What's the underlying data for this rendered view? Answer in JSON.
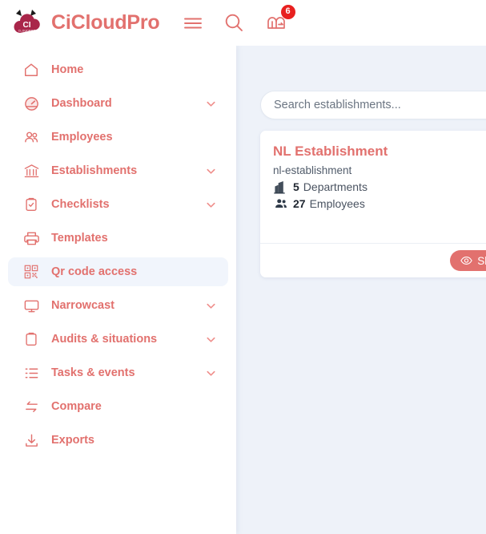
{
  "header": {
    "logo_alt": "cicloudpro-logo",
    "brand": "CiCloudPro",
    "logo_text": "CI",
    "icons": [
      {
        "name": "hamburger-menu-icon",
        "label": "Menu"
      },
      {
        "name": "search-icon",
        "label": "Search"
      },
      {
        "name": "mailbox-icon",
        "label": "Inbox"
      }
    ],
    "mailbox_badge": "6",
    "brand_color": "#e2716e",
    "badge_color": "#e8201f"
  },
  "sidebar": {
    "active_item": "Qr code access",
    "active_bg": "#f1f5fc",
    "items": [
      {
        "label": "Home",
        "icon": "home-icon",
        "chevron": false
      },
      {
        "label": "Dashboard",
        "icon": "gauge-icon",
        "chevron": true
      },
      {
        "label": "Employees",
        "icon": "users-icon",
        "chevron": false
      },
      {
        "label": "Establishments",
        "icon": "bank-icon",
        "chevron": true
      },
      {
        "label": "Checklists",
        "icon": "clipboard-check-icon",
        "chevron": true
      },
      {
        "label": "Templates",
        "icon": "printer-icon",
        "chevron": false
      },
      {
        "label": "Qr code access",
        "icon": "qr-code-icon",
        "chevron": false
      },
      {
        "label": "Narrowcast",
        "icon": "monitor-icon",
        "chevron": true
      },
      {
        "label": "Audits & situations",
        "icon": "clipboard-icon",
        "chevron": true
      },
      {
        "label": "Tasks & events",
        "icon": "list-icon",
        "chevron": true
      },
      {
        "label": "Compare",
        "icon": "compare-arrows-icon",
        "chevron": false
      },
      {
        "label": "Exports",
        "icon": "download-icon",
        "chevron": false
      }
    ]
  },
  "main": {
    "search": {
      "placeholder": "Search establishments...",
      "value": ""
    },
    "cards": [
      {
        "title": "NL Establishment",
        "slug": "nl-establishment",
        "stats": [
          {
            "icon": "building-icon",
            "value": "5",
            "label": "Departments"
          },
          {
            "icon": "users-icon",
            "value": "27",
            "label": "Employees"
          }
        ],
        "action_label": "Show",
        "action_icon": "eye-icon"
      }
    ]
  }
}
